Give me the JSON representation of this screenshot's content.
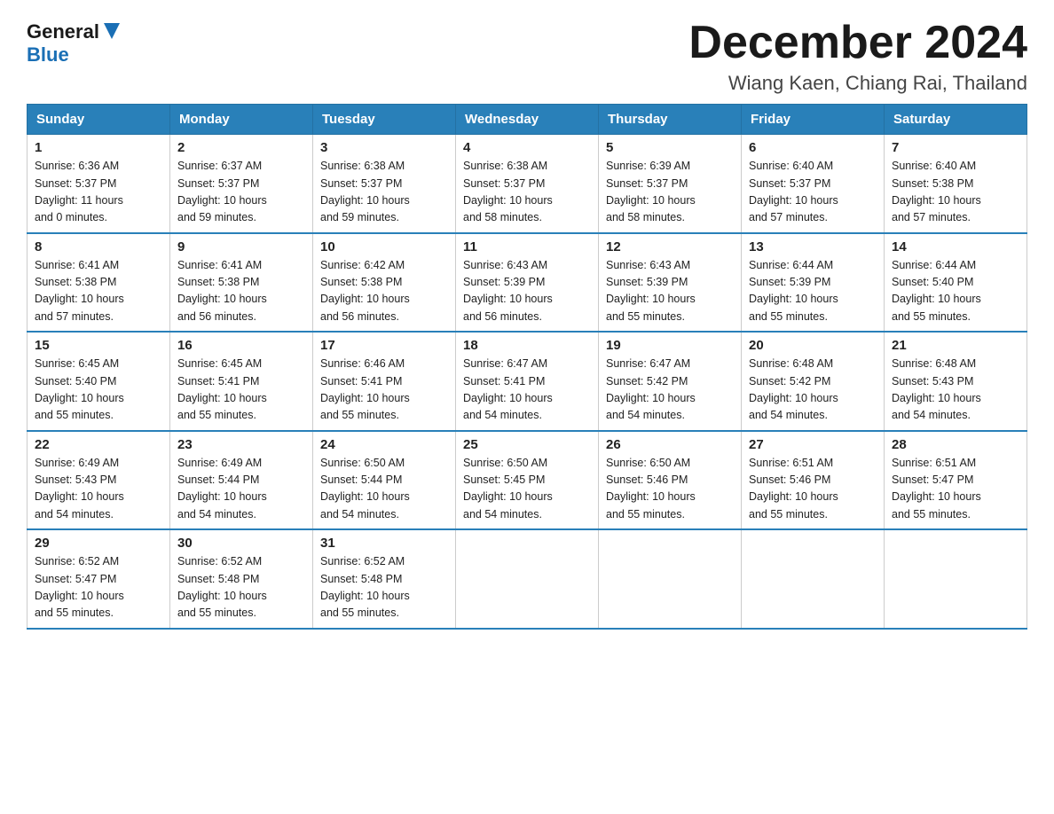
{
  "header": {
    "logo_line1": "General",
    "logo_line2": "Blue",
    "month_title": "December 2024",
    "location": "Wiang Kaen, Chiang Rai, Thailand"
  },
  "weekdays": [
    "Sunday",
    "Monday",
    "Tuesday",
    "Wednesday",
    "Thursday",
    "Friday",
    "Saturday"
  ],
  "weeks": [
    [
      {
        "day": "1",
        "sunrise": "6:36 AM",
        "sunset": "5:37 PM",
        "daylight": "11 hours and 0 minutes."
      },
      {
        "day": "2",
        "sunrise": "6:37 AM",
        "sunset": "5:37 PM",
        "daylight": "10 hours and 59 minutes."
      },
      {
        "day": "3",
        "sunrise": "6:38 AM",
        "sunset": "5:37 PM",
        "daylight": "10 hours and 59 minutes."
      },
      {
        "day": "4",
        "sunrise": "6:38 AM",
        "sunset": "5:37 PM",
        "daylight": "10 hours and 58 minutes."
      },
      {
        "day": "5",
        "sunrise": "6:39 AM",
        "sunset": "5:37 PM",
        "daylight": "10 hours and 58 minutes."
      },
      {
        "day": "6",
        "sunrise": "6:40 AM",
        "sunset": "5:37 PM",
        "daylight": "10 hours and 57 minutes."
      },
      {
        "day": "7",
        "sunrise": "6:40 AM",
        "sunset": "5:38 PM",
        "daylight": "10 hours and 57 minutes."
      }
    ],
    [
      {
        "day": "8",
        "sunrise": "6:41 AM",
        "sunset": "5:38 PM",
        "daylight": "10 hours and 57 minutes."
      },
      {
        "day": "9",
        "sunrise": "6:41 AM",
        "sunset": "5:38 PM",
        "daylight": "10 hours and 56 minutes."
      },
      {
        "day": "10",
        "sunrise": "6:42 AM",
        "sunset": "5:38 PM",
        "daylight": "10 hours and 56 minutes."
      },
      {
        "day": "11",
        "sunrise": "6:43 AM",
        "sunset": "5:39 PM",
        "daylight": "10 hours and 56 minutes."
      },
      {
        "day": "12",
        "sunrise": "6:43 AM",
        "sunset": "5:39 PM",
        "daylight": "10 hours and 55 minutes."
      },
      {
        "day": "13",
        "sunrise": "6:44 AM",
        "sunset": "5:39 PM",
        "daylight": "10 hours and 55 minutes."
      },
      {
        "day": "14",
        "sunrise": "6:44 AM",
        "sunset": "5:40 PM",
        "daylight": "10 hours and 55 minutes."
      }
    ],
    [
      {
        "day": "15",
        "sunrise": "6:45 AM",
        "sunset": "5:40 PM",
        "daylight": "10 hours and 55 minutes."
      },
      {
        "day": "16",
        "sunrise": "6:45 AM",
        "sunset": "5:41 PM",
        "daylight": "10 hours and 55 minutes."
      },
      {
        "day": "17",
        "sunrise": "6:46 AM",
        "sunset": "5:41 PM",
        "daylight": "10 hours and 55 minutes."
      },
      {
        "day": "18",
        "sunrise": "6:47 AM",
        "sunset": "5:41 PM",
        "daylight": "10 hours and 54 minutes."
      },
      {
        "day": "19",
        "sunrise": "6:47 AM",
        "sunset": "5:42 PM",
        "daylight": "10 hours and 54 minutes."
      },
      {
        "day": "20",
        "sunrise": "6:48 AM",
        "sunset": "5:42 PM",
        "daylight": "10 hours and 54 minutes."
      },
      {
        "day": "21",
        "sunrise": "6:48 AM",
        "sunset": "5:43 PM",
        "daylight": "10 hours and 54 minutes."
      }
    ],
    [
      {
        "day": "22",
        "sunrise": "6:49 AM",
        "sunset": "5:43 PM",
        "daylight": "10 hours and 54 minutes."
      },
      {
        "day": "23",
        "sunrise": "6:49 AM",
        "sunset": "5:44 PM",
        "daylight": "10 hours and 54 minutes."
      },
      {
        "day": "24",
        "sunrise": "6:50 AM",
        "sunset": "5:44 PM",
        "daylight": "10 hours and 54 minutes."
      },
      {
        "day": "25",
        "sunrise": "6:50 AM",
        "sunset": "5:45 PM",
        "daylight": "10 hours and 54 minutes."
      },
      {
        "day": "26",
        "sunrise": "6:50 AM",
        "sunset": "5:46 PM",
        "daylight": "10 hours and 55 minutes."
      },
      {
        "day": "27",
        "sunrise": "6:51 AM",
        "sunset": "5:46 PM",
        "daylight": "10 hours and 55 minutes."
      },
      {
        "day": "28",
        "sunrise": "6:51 AM",
        "sunset": "5:47 PM",
        "daylight": "10 hours and 55 minutes."
      }
    ],
    [
      {
        "day": "29",
        "sunrise": "6:52 AM",
        "sunset": "5:47 PM",
        "daylight": "10 hours and 55 minutes."
      },
      {
        "day": "30",
        "sunrise": "6:52 AM",
        "sunset": "5:48 PM",
        "daylight": "10 hours and 55 minutes."
      },
      {
        "day": "31",
        "sunrise": "6:52 AM",
        "sunset": "5:48 PM",
        "daylight": "10 hours and 55 minutes."
      },
      null,
      null,
      null,
      null
    ]
  ],
  "labels": {
    "sunrise": "Sunrise:",
    "sunset": "Sunset:",
    "daylight": "Daylight:"
  }
}
